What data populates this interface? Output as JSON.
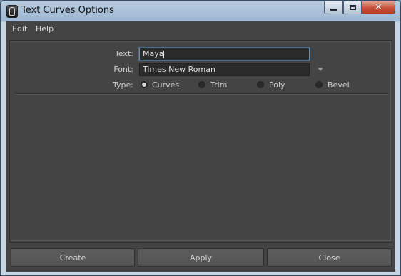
{
  "window": {
    "title": "Text Curves Options",
    "close_glyph": "✕"
  },
  "menu": {
    "items": [
      {
        "label": "Edit"
      },
      {
        "label": "Help"
      }
    ]
  },
  "form": {
    "text_label": "Text:",
    "text_value": "Maya",
    "font_label": "Font:",
    "font_value": "Times New Roman",
    "type_label": "Type:",
    "type_options": [
      {
        "label": "Curves",
        "selected": true
      },
      {
        "label": "Trim",
        "selected": false
      },
      {
        "label": "Poly",
        "selected": false
      },
      {
        "label": "Bevel",
        "selected": false
      }
    ]
  },
  "buttons": {
    "create_label": "Create",
    "apply_label": "Apply",
    "close_label": "Close"
  },
  "colors": {
    "panel_bg": "#444444",
    "field_bg": "#2b2b2b",
    "focus_border": "#6a8fb0"
  }
}
